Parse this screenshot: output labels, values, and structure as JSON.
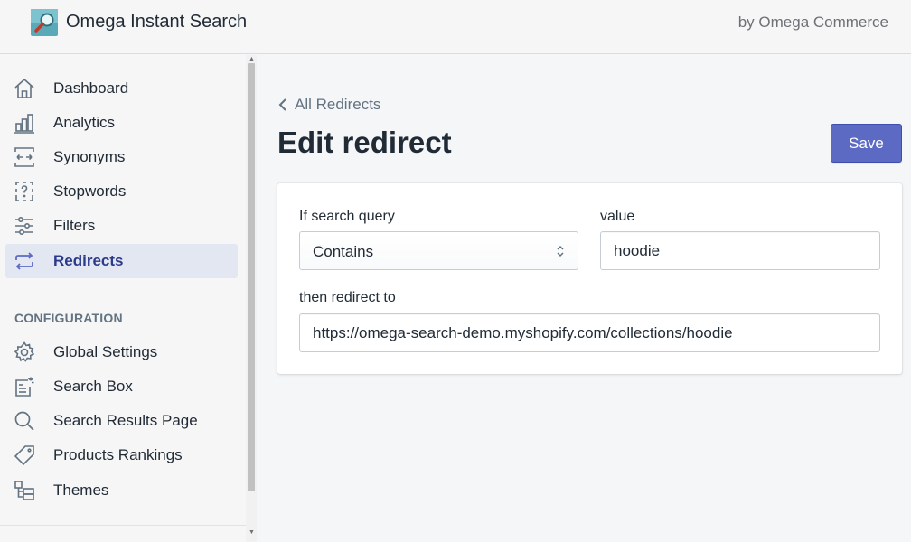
{
  "app": {
    "title": "Omega Instant Search",
    "byline": "by Omega Commerce"
  },
  "sidebar": {
    "items": [
      {
        "label": "Dashboard",
        "icon": "home-icon"
      },
      {
        "label": "Analytics",
        "icon": "bar-chart-icon"
      },
      {
        "label": "Synonyms",
        "icon": "arrows-horizontal-icon"
      },
      {
        "label": "Stopwords",
        "icon": "question-dashed-icon"
      },
      {
        "label": "Filters",
        "icon": "sliders-icon"
      },
      {
        "label": "Redirects",
        "icon": "redirect-arrows-icon",
        "active": true
      }
    ],
    "config_heading": "CONFIGURATION",
    "config_items": [
      {
        "label": "Global Settings",
        "icon": "gear-icon"
      },
      {
        "label": "Search Box",
        "icon": "search-box-icon"
      },
      {
        "label": "Search Results Page",
        "icon": "search-icon"
      },
      {
        "label": "Products Rankings",
        "icon": "tag-icon"
      },
      {
        "label": "Themes",
        "icon": "themes-icon"
      }
    ]
  },
  "main": {
    "breadcrumb": "All Redirects",
    "title": "Edit redirect",
    "save_label": "Save",
    "form": {
      "condition_label": "If search query",
      "condition_value": "Contains",
      "value_label": "value",
      "value": "hoodie",
      "redirect_label": "then redirect to",
      "redirect_value": "https://omega-search-demo.myshopify.com/collections/hoodie"
    }
  },
  "colors": {
    "primary": "#5c6ac4",
    "active_nav_bg": "#e3e7f1",
    "active_nav_text": "#2c3a8c",
    "icon": "#637381"
  }
}
